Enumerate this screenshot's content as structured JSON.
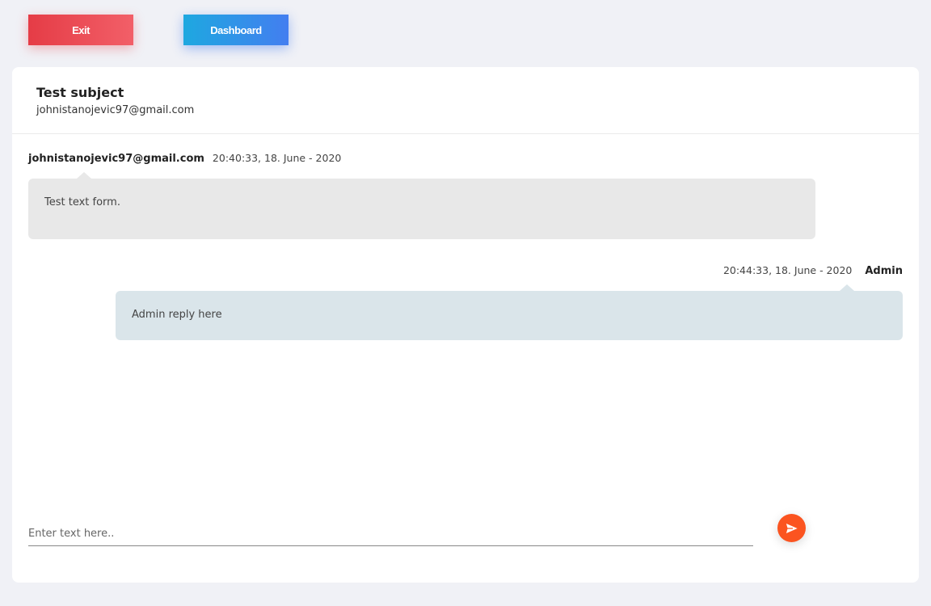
{
  "buttons": {
    "exit": "Exit",
    "dashboard": "Dashboard"
  },
  "ticket": {
    "subject": "Test subject",
    "email": "johnistanojevic97@gmail.com"
  },
  "messages": [
    {
      "author": "johnistanojevic97@gmail.com",
      "time": "20:40:33, 18. June - 2020",
      "text": "Test text form."
    },
    {
      "author": "Admin",
      "time": "20:44:33, 18. June - 2020",
      "text": "Admin reply here"
    }
  ],
  "composer": {
    "placeholder": "Enter text here..",
    "send_icon": "send-icon"
  },
  "colors": {
    "exit": "#e53c46",
    "dashboard": "#437ef0",
    "send": "#fb5420"
  }
}
